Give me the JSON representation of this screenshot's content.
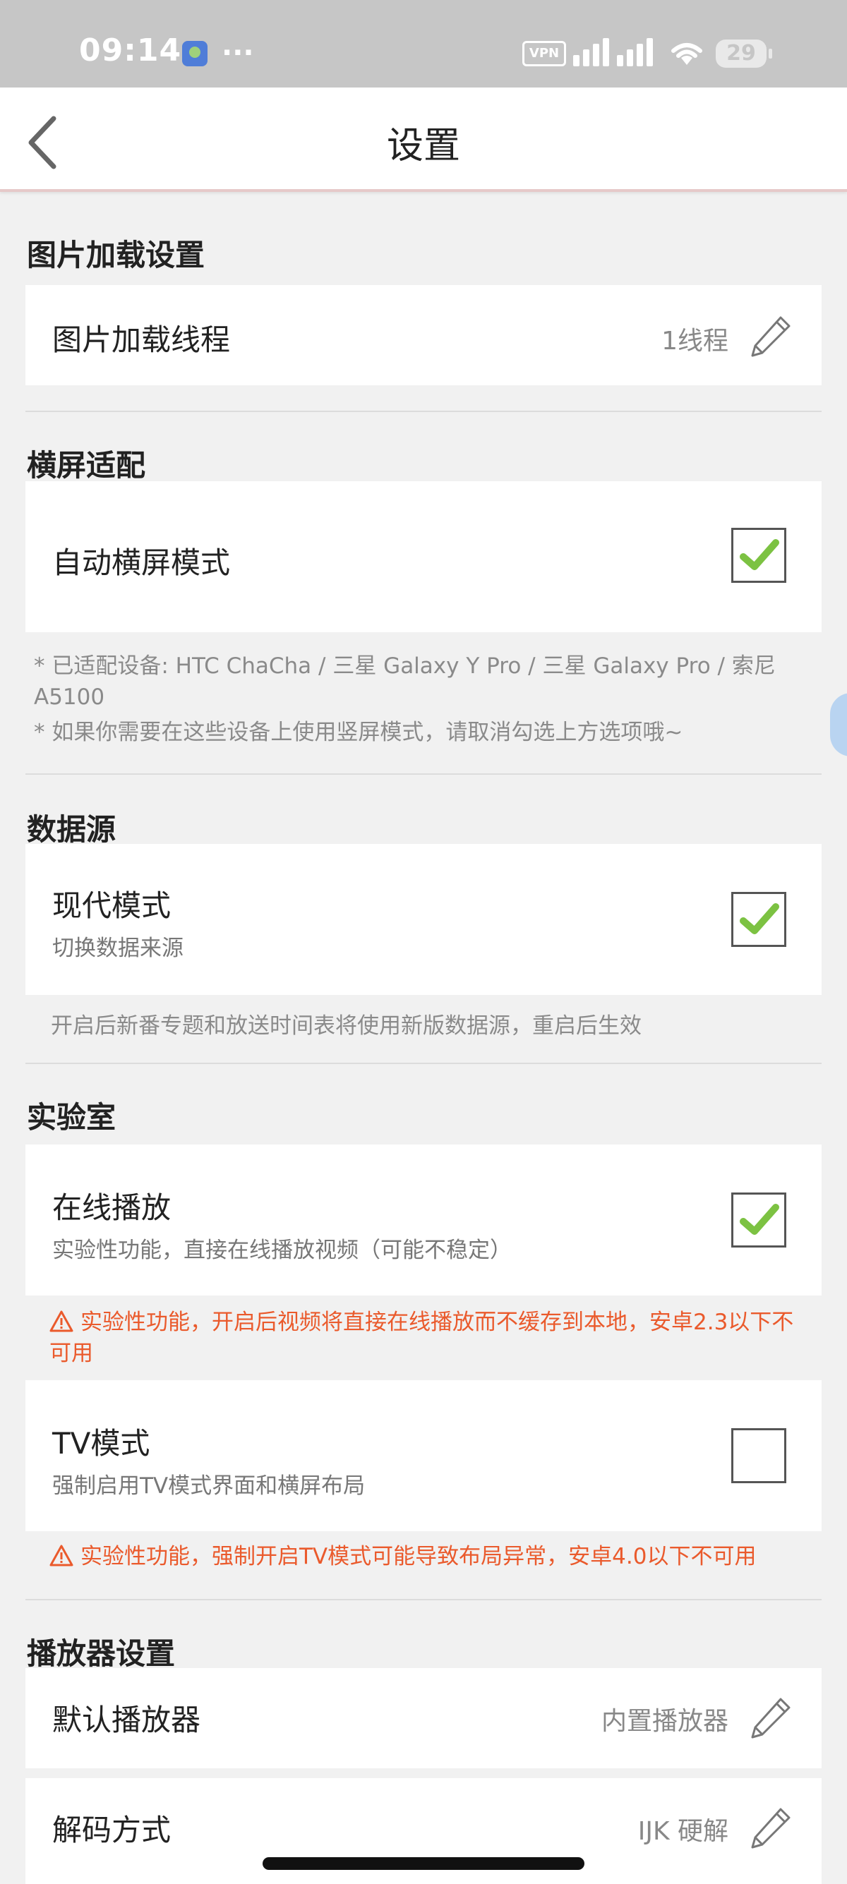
{
  "status_bar": {
    "time": "09:14",
    "dots": "···",
    "vpn": "VPN",
    "battery": "29"
  },
  "header": {
    "title": "设置"
  },
  "sections": {
    "image_loading": {
      "title": "图片加载设置",
      "threads_label": "图片加载线程",
      "threads_value": "1线程"
    },
    "landscape": {
      "title": "横屏适配",
      "auto_label": "自动横屏模式",
      "auto_checked": true,
      "note_line1": "* 已适配设备: HTC ChaCha / 三星 Galaxy Y Pro / 三星 Galaxy Pro / 索尼 A5100",
      "note_line2": "* 如果你需要在这些设备上使用竖屏模式，请取消勾选上方选项哦~"
    },
    "data_source": {
      "title": "数据源",
      "modern_label": "现代模式",
      "modern_sub": "切换数据来源",
      "modern_checked": true,
      "note": "开启后新番专题和放送时间表将使用新版数据源，重启后生效"
    },
    "lab": {
      "title": "实验室",
      "online_label": "在线播放",
      "online_sub": "实验性功能，直接在线播放视频（可能不稳定）",
      "online_checked": true,
      "online_warn": "实验性功能，开启后视频将直接在线播放而不缓存到本地，安卓2.3以下不可用",
      "tv_label": "TV模式",
      "tv_sub": "强制启用TV模式界面和横屏布局",
      "tv_checked": false,
      "tv_warn": "实验性功能，强制开启TV模式可能导致布局异常，安卓4.0以下不可用"
    },
    "player": {
      "title": "播放器设置",
      "default_label": "默认播放器",
      "default_value": "内置播放器",
      "decode_label": "解码方式",
      "decode_value": "IJK 硬解"
    }
  },
  "colors": {
    "check_green": "#7cc242",
    "warning_orange": "#ea5a2c"
  }
}
